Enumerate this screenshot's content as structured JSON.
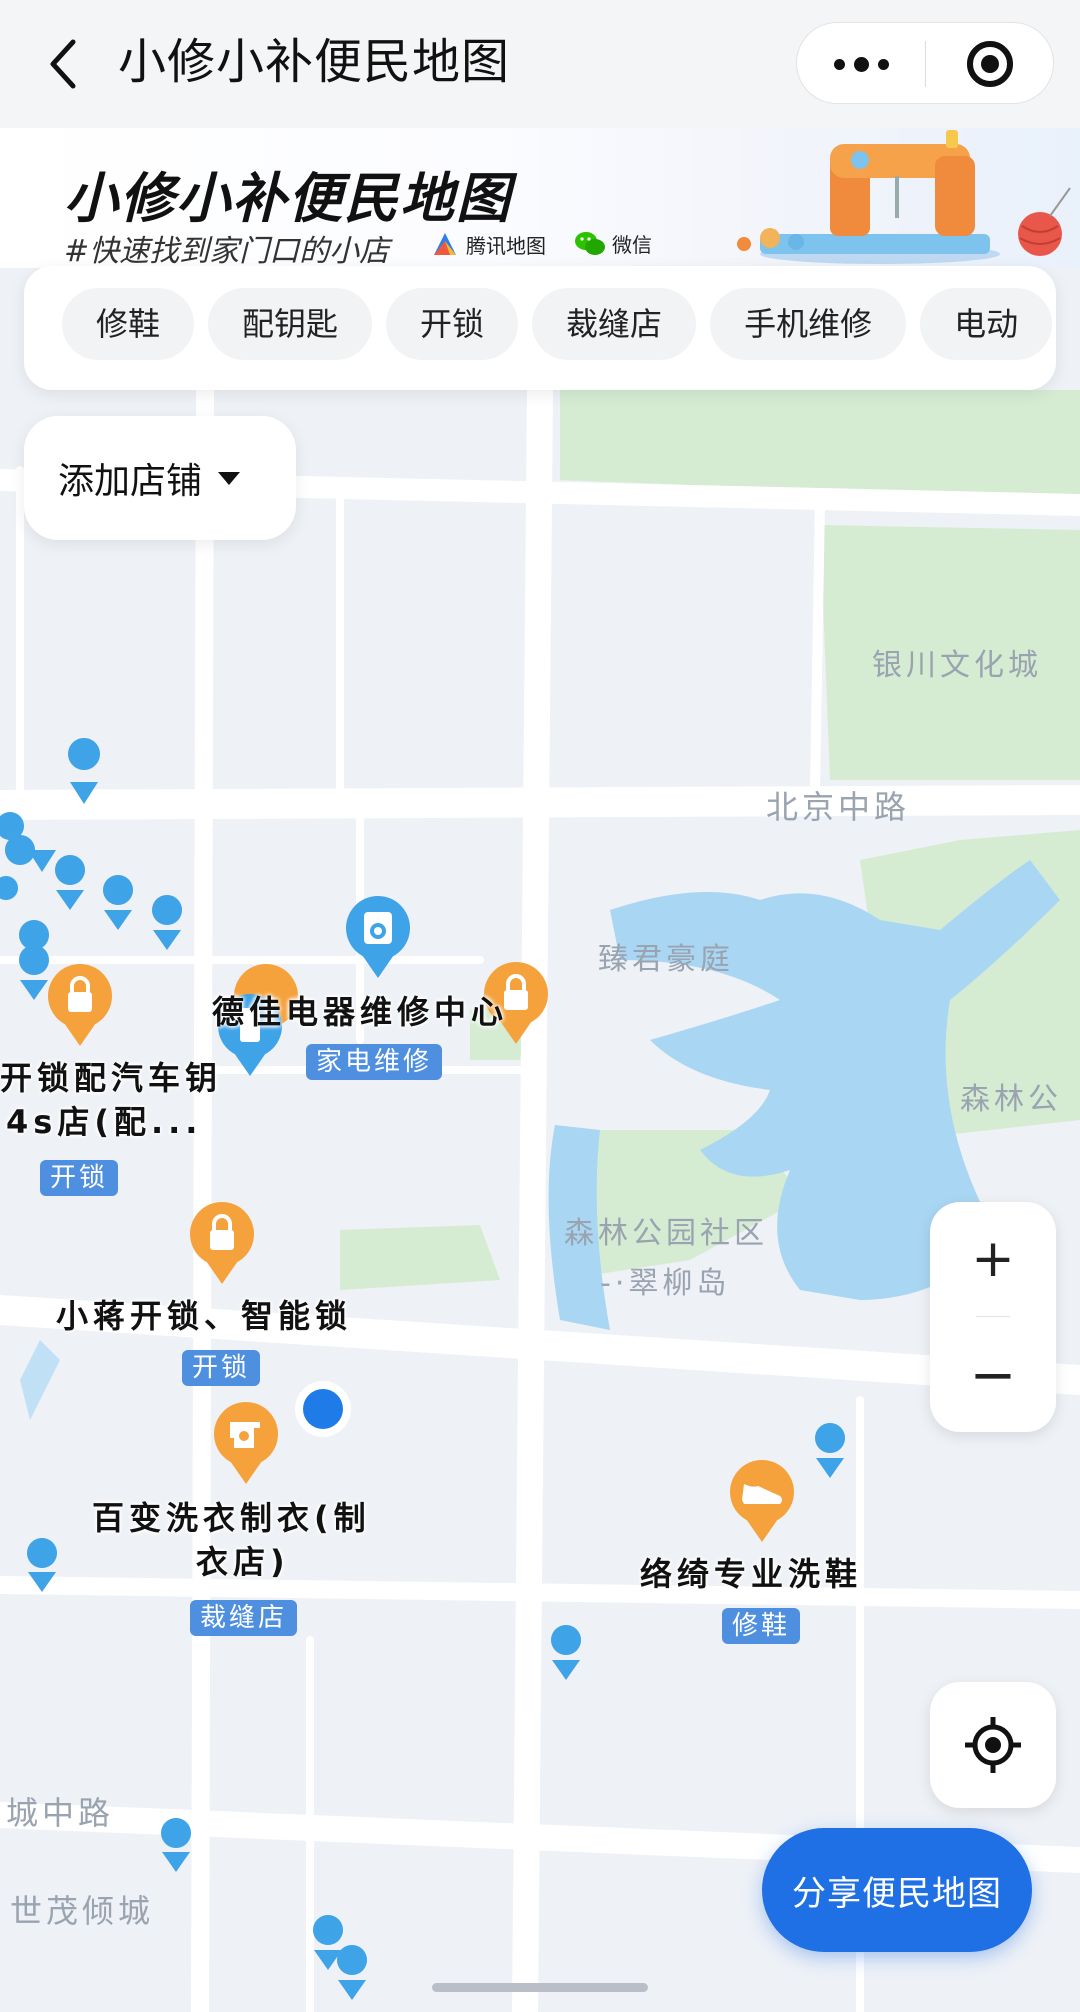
{
  "nav": {
    "title": "小修小补便民地图"
  },
  "banner": {
    "title": "小修小补便民地图",
    "subtitle": "#快速找到家门口的小店",
    "partner1": "腾讯地图",
    "partner2": "微信"
  },
  "categories": [
    "修鞋",
    "配钥匙",
    "开锁",
    "裁缝店",
    "手机维修",
    "电动"
  ],
  "add_store": {
    "label": "添加店铺"
  },
  "map_labels": {
    "culture_city": "银川文化城",
    "beijing_road": "北京中路",
    "zhenjun": "臻君豪庭",
    "forest_park": "森林公",
    "community1": "森林公园社区",
    "community2": "-·翠柳岛",
    "city_road": "城中路",
    "shimao": "世茂倾城"
  },
  "pois": [
    {
      "name": "德佳电器维修中心",
      "tag": "家电维修"
    },
    {
      "name_line1": "开锁配汽车钥",
      "name_line2": "4s店(配...",
      "tag": "开锁"
    },
    {
      "name": "小蒋开锁、智能锁",
      "tag": "开锁"
    },
    {
      "name_line1": "百变洗衣制衣(制",
      "name_line2": "衣店)",
      "tag": "裁缝店"
    },
    {
      "name": "络绮专业洗鞋",
      "tag": "修鞋"
    }
  ],
  "controls": {
    "zoom_in": "+",
    "zoom_out": "−",
    "share": "分享便民地图"
  },
  "colors": {
    "accent": "#1f6fe5",
    "tag_blue": "#4f8fdf",
    "pin_orange": "#f5a23c",
    "pin_blue": "#3fa3e8",
    "map_green": "#d4ecd0",
    "water": "#a9d6f2"
  },
  "icons": [
    "back-icon",
    "more-icon",
    "target-icon",
    "dropdown-icon",
    "lock-icon",
    "washer-icon",
    "sewing-machine-icon",
    "shoe-icon",
    "locate-icon"
  ]
}
